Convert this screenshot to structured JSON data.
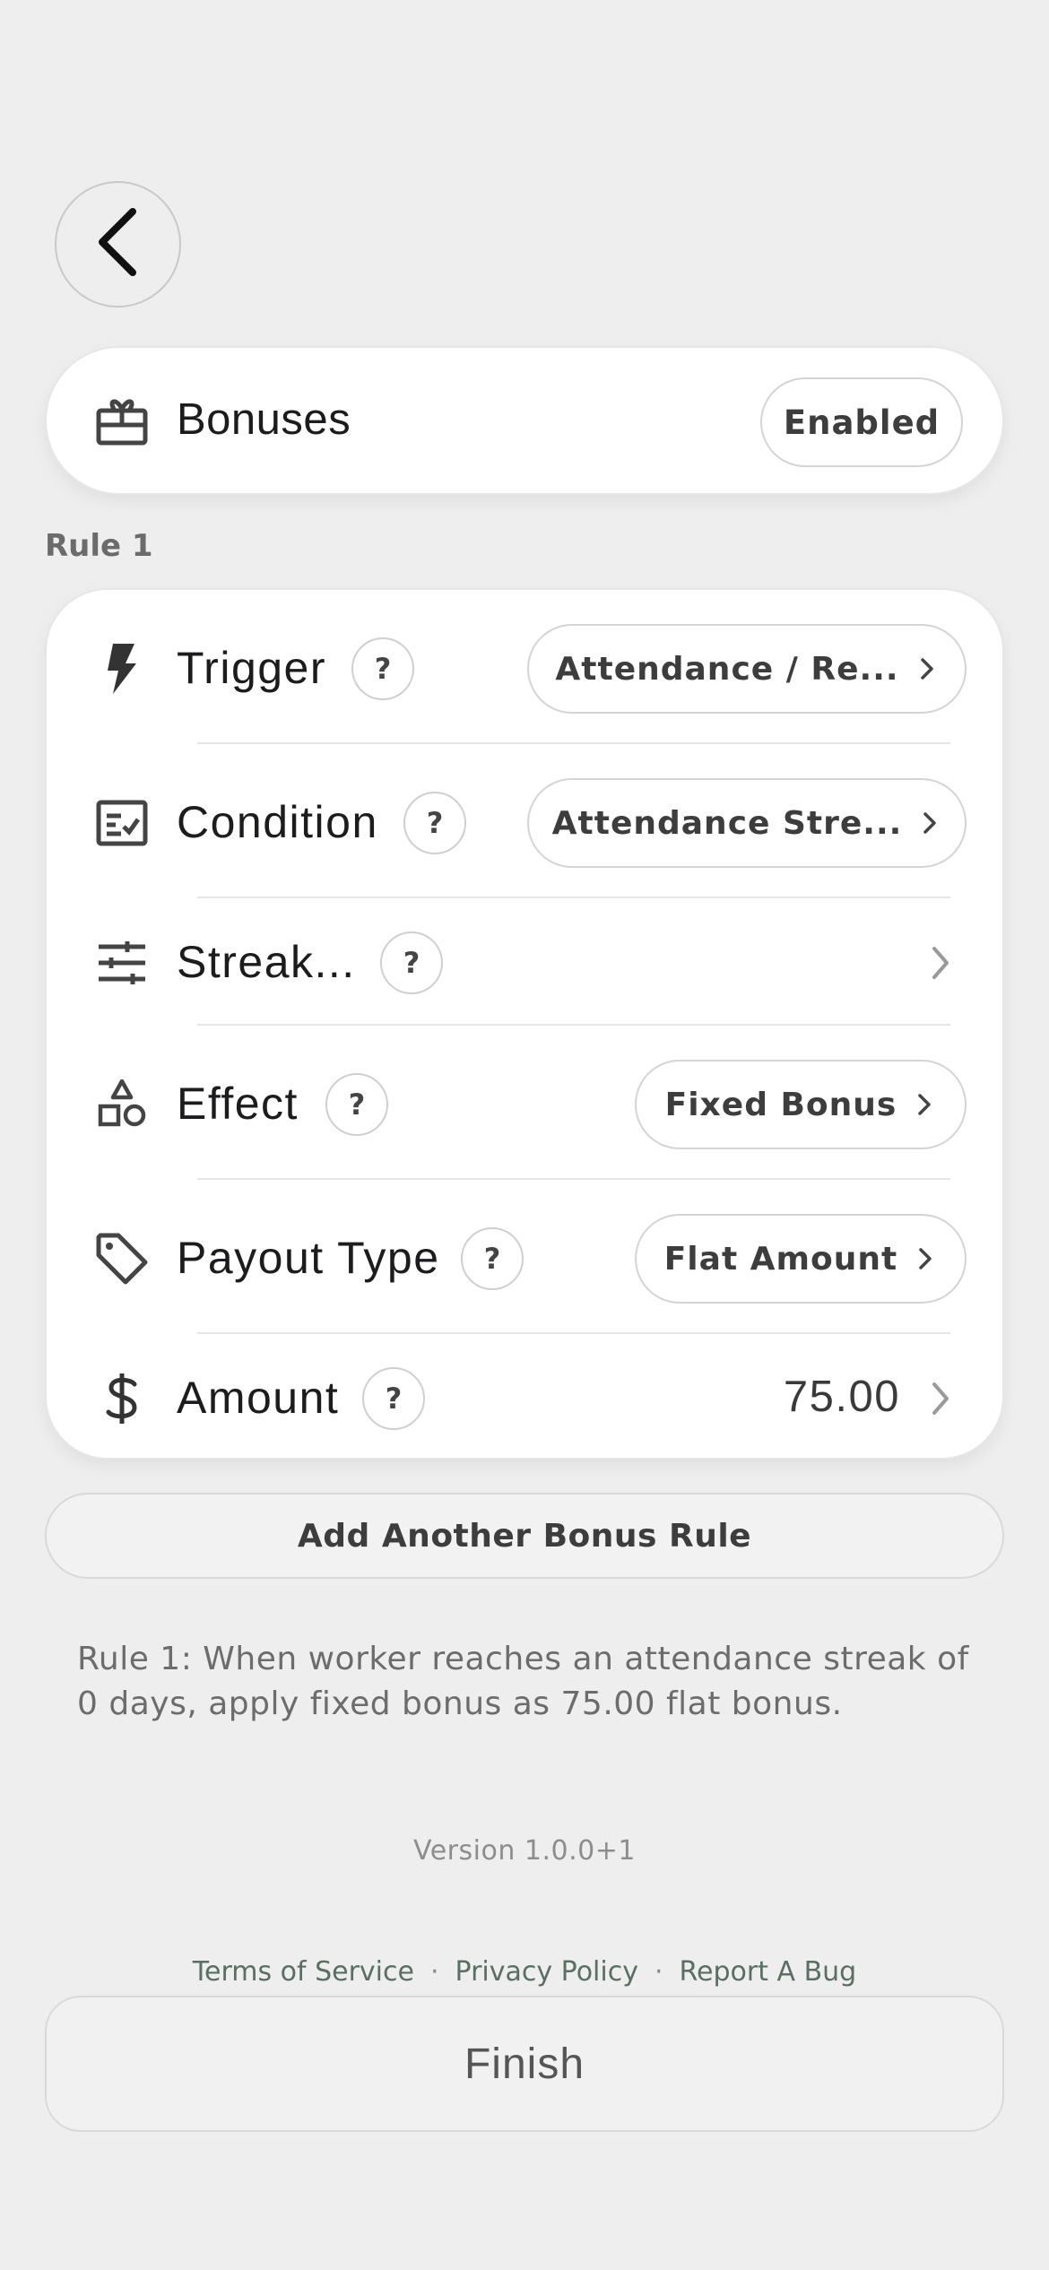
{
  "bonuses": {
    "title": "Bonuses",
    "status": "Enabled"
  },
  "rule": {
    "heading": "Rule 1",
    "rows": [
      {
        "label": "Trigger",
        "help": "?",
        "value": "Attendance / Re..."
      },
      {
        "label": "Condition",
        "help": "?",
        "value": "Attendance Stre..."
      },
      {
        "label": "Streak...",
        "help": "?"
      },
      {
        "label": "Effect",
        "help": "?",
        "value": "Fixed Bonus"
      },
      {
        "label": "Payout Type",
        "help": "?",
        "value": "Flat Amount"
      },
      {
        "label": "Amount",
        "help": "?",
        "value": "75.00"
      }
    ]
  },
  "add_rule_label": "Add Another Bonus Rule",
  "summary": "Rule 1: When worker reaches an attendance streak of 0 days, apply fixed bonus as 75.00 flat bonus.",
  "version": "Version 1.0.0+1",
  "footer": {
    "terms": "Terms of Service",
    "privacy": "Privacy Policy",
    "bug": "Report A Bug",
    "separator": "·"
  },
  "finish_label": "Finish",
  "icons": {
    "back": "chevron-left-icon",
    "bonuses": "gift-card-icon",
    "trigger": "bolt-icon",
    "condition": "checklist-icon",
    "streak": "sliders-icon",
    "effect": "shapes-icon",
    "payout": "tag-icon",
    "amount": "dollar-icon"
  }
}
